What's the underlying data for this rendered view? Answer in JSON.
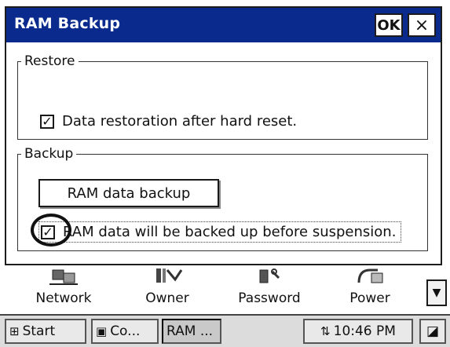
{
  "window": {
    "title": "RAM Backup",
    "ok_label": "OK",
    "close_label": "×"
  },
  "restore": {
    "legend": "Restore",
    "checkbox_checked": true,
    "checkbox_mark": "✓",
    "label": "Data restoration after hard reset."
  },
  "backup": {
    "legend": "Backup",
    "button_label": "RAM data backup",
    "checkbox_checked": true,
    "checkbox_mark": "✓",
    "label": "RAM data will be backed up before suspension."
  },
  "control_panel": {
    "items": [
      {
        "label": "Network",
        "icon": "network-icon"
      },
      {
        "label": "Owner",
        "icon": "owner-icon"
      },
      {
        "label": "Password",
        "icon": "password-icon"
      },
      {
        "label": "Power",
        "icon": "power-icon"
      }
    ],
    "scroll_glyph": "▼"
  },
  "taskbar": {
    "start_label": "Start",
    "tasks": [
      "Co...",
      "RAM ..."
    ],
    "time": "10:46 PM",
    "colors": {
      "titlebar": "#0a2a8e"
    }
  }
}
